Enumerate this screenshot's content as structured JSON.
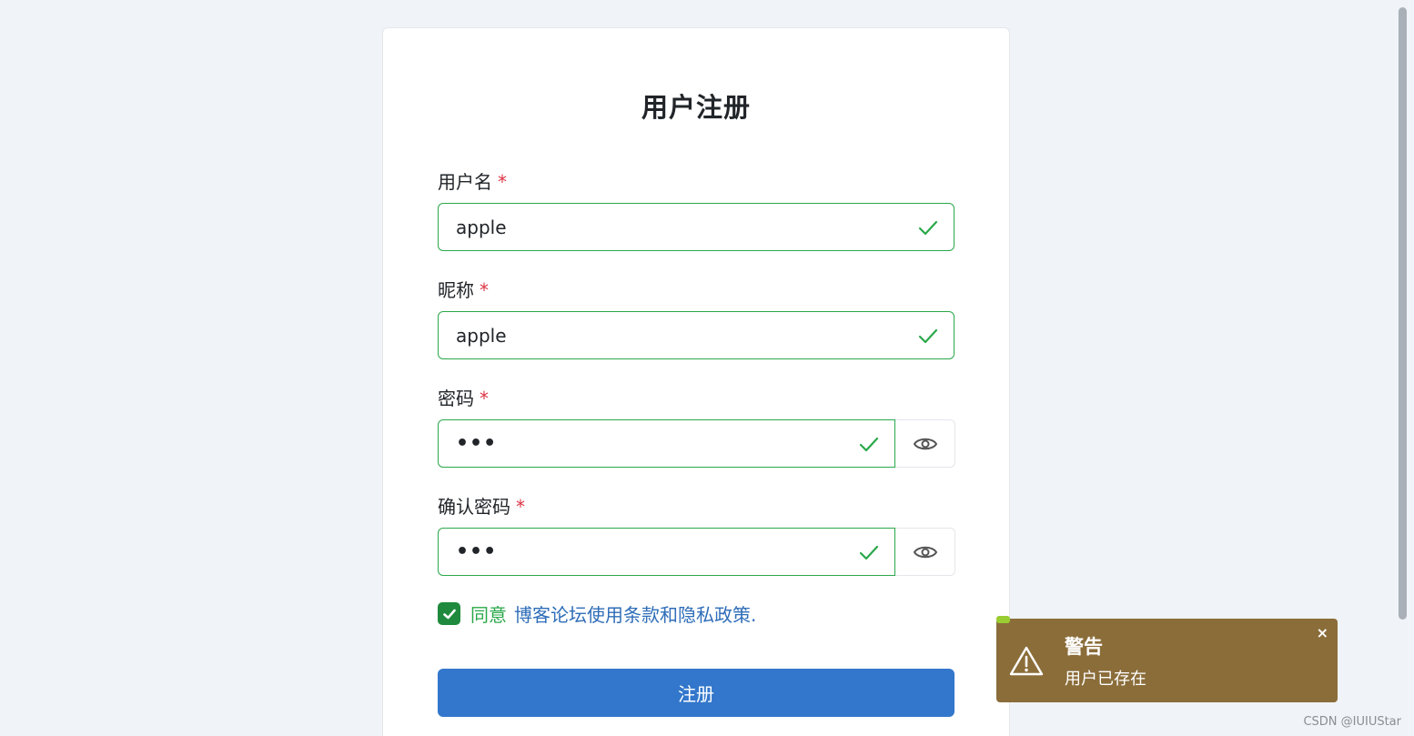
{
  "form": {
    "title": "用户注册",
    "required_mark": "*",
    "username": {
      "label": "用户名",
      "value": "apple"
    },
    "nickname": {
      "label": "昵称",
      "value": "apple"
    },
    "password": {
      "label": "密码",
      "value": "•••"
    },
    "confirm_password": {
      "label": "确认密码",
      "value": "•••"
    },
    "agree": {
      "checked": true,
      "text": "同意",
      "link": "博客论坛使用条款和隐私政策."
    },
    "submit_label": "注册",
    "icons": {
      "valid": "check-icon",
      "reveal": "eye-icon",
      "checkbox": "checkbox-checked-icon"
    }
  },
  "toast": {
    "title": "警告",
    "message": "用户已存在",
    "close_label": "×",
    "icon": "warning-triangle-icon",
    "color": "#8b6d3a"
  },
  "watermark": "CSDN @IUIUStar",
  "colors": {
    "valid_border": "#2aa84a",
    "required": "#dc3545",
    "primary": "#3377cc",
    "link": "#2f6db8"
  }
}
